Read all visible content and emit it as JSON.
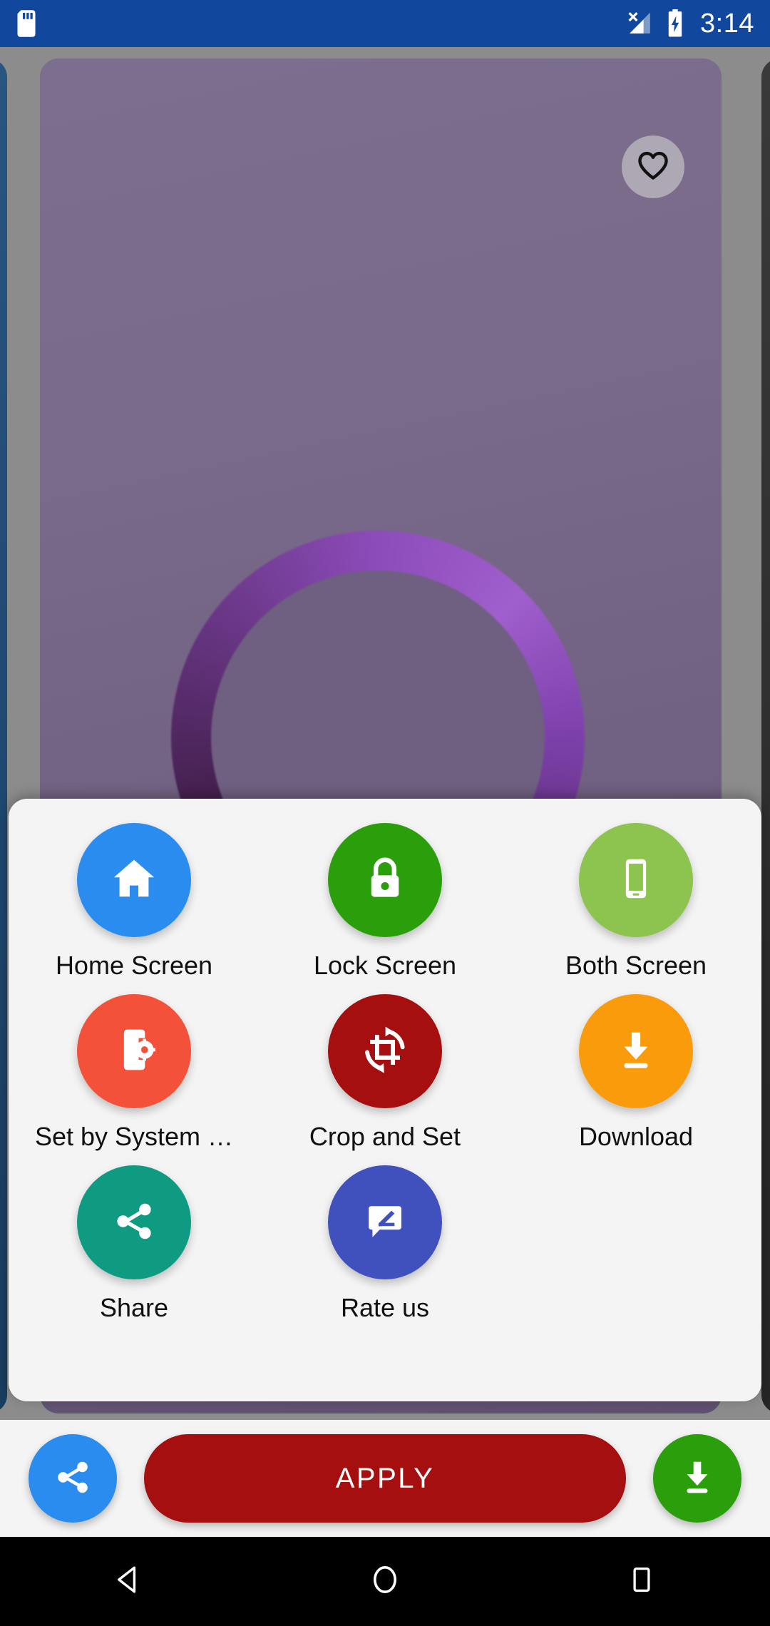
{
  "status_bar": {
    "background_color": "#12479e",
    "time": "3:14",
    "icons": [
      {
        "name": "sd-card-icon",
        "position": "left"
      },
      {
        "name": "signal-off-icon",
        "position": "right"
      },
      {
        "name": "battery-charging-icon",
        "position": "right"
      }
    ]
  },
  "wallpaper_preview": {
    "favorite_icon": "heart-outline-icon",
    "current_card_colors": [
      "#7c6e8e",
      "#5f4f70"
    ],
    "prev_card_color": "#2c5b86",
    "next_card_color": "#3a3a3a",
    "pager_background": "#8c8c8c"
  },
  "options_sheet": {
    "background_color": "#f4f4f4",
    "options": [
      {
        "label": "Home Screen",
        "icon": "home-icon",
        "color": "#2b8cf0"
      },
      {
        "label": "Lock Screen",
        "icon": "lock-icon",
        "color": "#2b9e0b"
      },
      {
        "label": "Both Screen",
        "icon": "smartphone-icon",
        "color": "#8cc44f"
      },
      {
        "label": "Set by System …",
        "icon": "phone-settings-icon",
        "color": "#f4513a"
      },
      {
        "label": "Crop and Set",
        "icon": "crop-rotate-icon",
        "color": "#a50f0f"
      },
      {
        "label": "Download",
        "icon": "download-icon",
        "color": "#fa9b0c"
      },
      {
        "label": "Share",
        "icon": "share-icon",
        "color": "#0e9b82"
      },
      {
        "label": "Rate us",
        "icon": "rate-review-icon",
        "color": "#4050bd"
      }
    ]
  },
  "action_bar": {
    "background_color": "#f4f4f4",
    "share_button": {
      "icon": "share-icon",
      "color": "#2b8cf0"
    },
    "apply_button": {
      "label": "APPLY",
      "color": "#a50f0f",
      "text_color": "#ffffff"
    },
    "download_button": {
      "icon": "download-icon",
      "color": "#2b9e0b"
    }
  },
  "nav_bar": {
    "background_color": "#000000",
    "buttons": [
      {
        "name": "back-button",
        "icon": "triangle-back-icon"
      },
      {
        "name": "home-button",
        "icon": "circle-home-icon"
      },
      {
        "name": "recents-button",
        "icon": "square-recents-icon"
      }
    ]
  }
}
